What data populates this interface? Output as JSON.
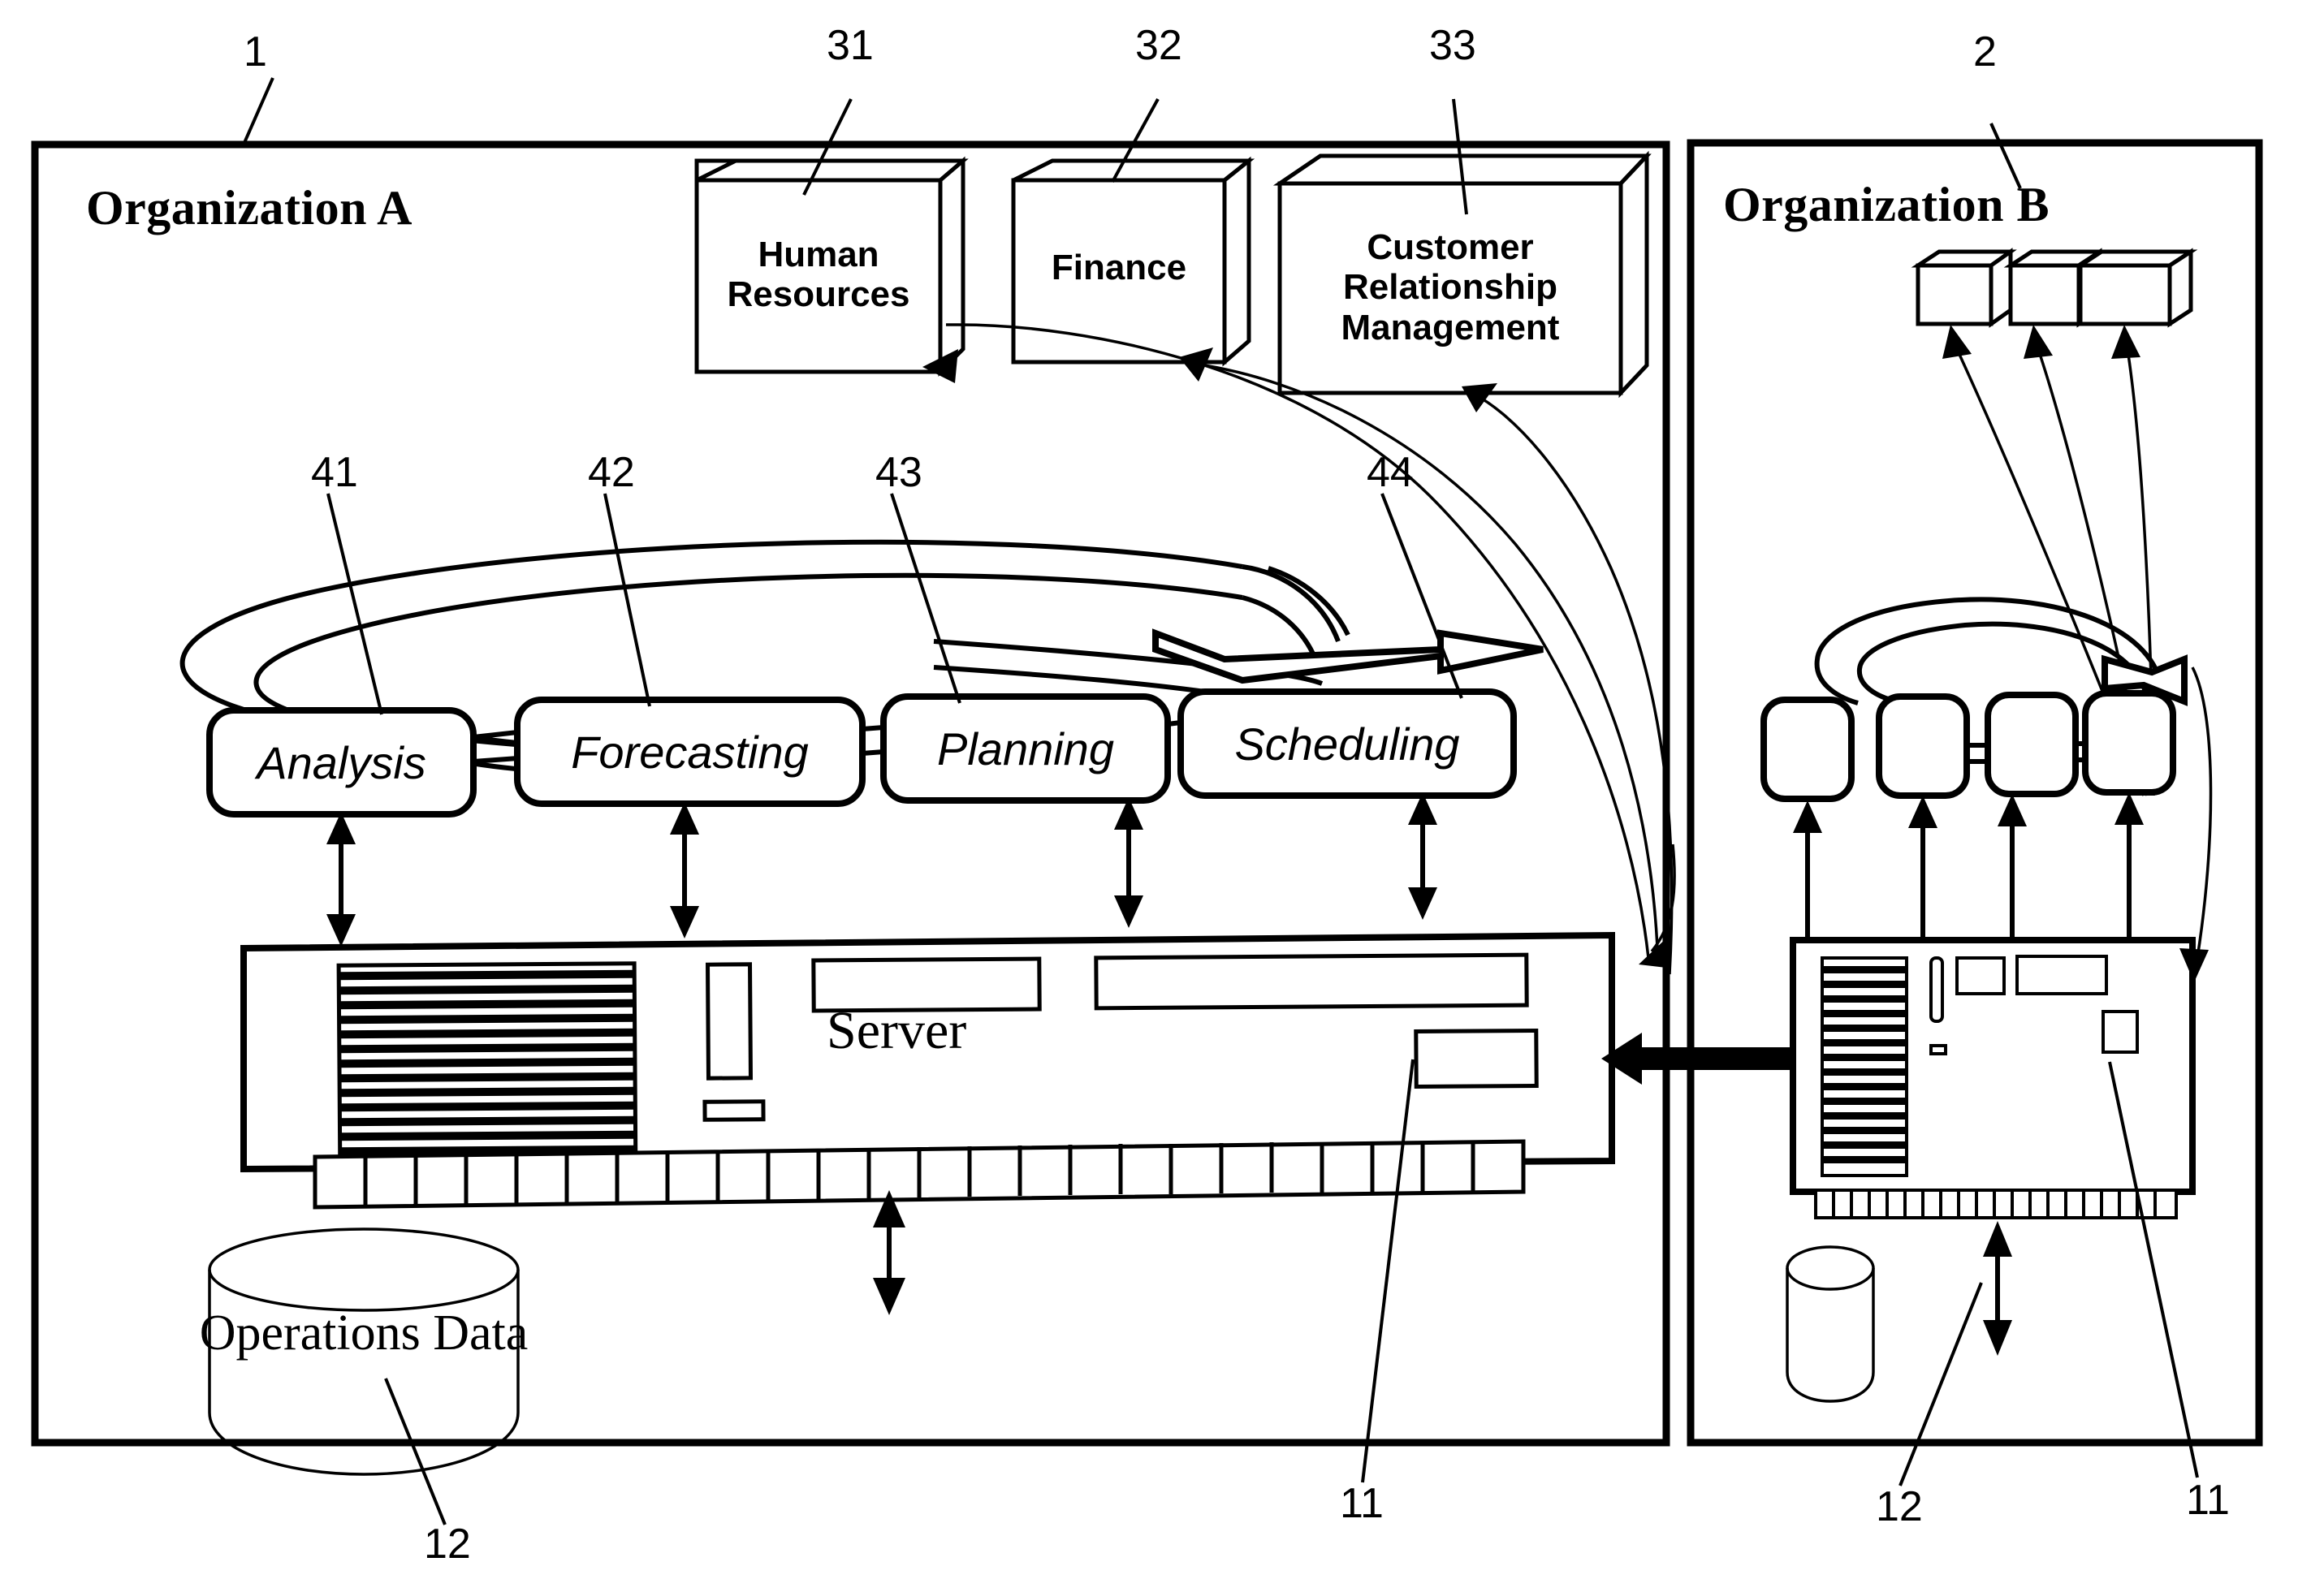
{
  "figure": {
    "type": "patent-diagram",
    "panels": [
      {
        "id": "org-a",
        "title": "Organization A",
        "ref": "1",
        "server_label": "Server",
        "server_ref": "11",
        "database_label": "Operations Data",
        "database_ref": "12",
        "applications": [
          {
            "label_line1": "Human",
            "label_line2": "Resources",
            "label_line3": "",
            "ref": "31"
          },
          {
            "label_line1": "Finance",
            "label_line2": "",
            "label_line3": "",
            "ref": "32"
          },
          {
            "label_line1": "Customer",
            "label_line2": "Relationship",
            "label_line3": "Management",
            "ref": "33"
          }
        ],
        "processes": [
          {
            "label": "Analysis",
            "ref": "41"
          },
          {
            "label": "Forecasting",
            "ref": "42"
          },
          {
            "label": "Planning",
            "ref": "43"
          },
          {
            "label": "Scheduling",
            "ref": "44"
          }
        ]
      },
      {
        "id": "org-b",
        "title": "Organization B",
        "ref": "2",
        "server_ref": "11",
        "database_ref": "12",
        "applications": [
          {
            "label": "",
            "ref": ""
          },
          {
            "label": "",
            "ref": ""
          },
          {
            "label": "",
            "ref": ""
          }
        ],
        "processes": [
          {
            "label": ""
          },
          {
            "label": ""
          },
          {
            "label": ""
          },
          {
            "label": ""
          }
        ]
      }
    ],
    "colors": {
      "ink": "#000000",
      "paper": "#ffffff"
    }
  }
}
